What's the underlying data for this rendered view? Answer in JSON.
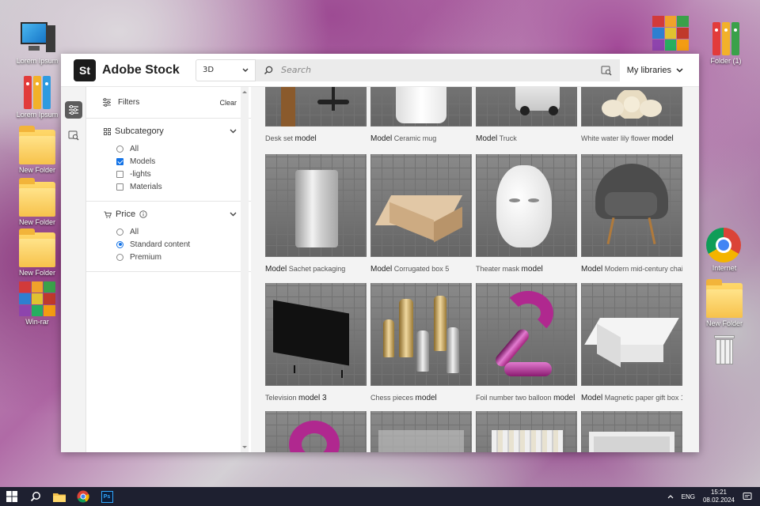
{
  "desktop": {
    "left_icons": [
      {
        "label": "Lorem Ipsum",
        "icon": "computer-icon"
      },
      {
        "label": "Lorem Ipsum",
        "icon": "binders-icon"
      },
      {
        "label": "New Folder",
        "icon": "folder-icon"
      },
      {
        "label": "New Folder",
        "icon": "folder-icon"
      },
      {
        "label": "New Folder",
        "icon": "folder-icon"
      },
      {
        "label": "Win-rar",
        "icon": "winrar-icon"
      }
    ],
    "right_icons": [
      {
        "label": "",
        "icon": "winrar-icon"
      },
      {
        "label": "Folder (1)",
        "icon": "binders-icon"
      },
      {
        "label": "Internet",
        "icon": "chrome-icon"
      },
      {
        "label": "New Folder",
        "icon": "folder-icon"
      },
      {
        "label": "",
        "icon": "recycle-bin-icon"
      }
    ]
  },
  "app": {
    "logo": "St",
    "name": "Adobe Stock",
    "category": "3D",
    "search_placeholder": "Search",
    "libraries": "My libraries"
  },
  "filters": {
    "title": "Filters",
    "clear": "Clear",
    "subcategory": {
      "title": "Subcategory",
      "options": [
        {
          "label": "All",
          "checked": false
        },
        {
          "label": "Models",
          "checked": true
        },
        {
          "label": "-lights",
          "checked": false
        },
        {
          "label": "Materials",
          "checked": false
        }
      ]
    },
    "price": {
      "title": "Price",
      "options": [
        {
          "label": "All",
          "selected": false
        },
        {
          "label": "Standard content",
          "selected": true
        },
        {
          "label": "Premium",
          "selected": false
        }
      ]
    }
  },
  "results": [
    {
      "pre": "Desk set",
      "bold": "model",
      "post": ""
    },
    {
      "pre": "",
      "bold": "Model",
      "post": "Ceramic mug"
    },
    {
      "pre": "",
      "bold": "Model",
      "post": "Truck"
    },
    {
      "pre": "White water lily flower",
      "bold": "model",
      "post": ""
    },
    {
      "pre": "",
      "bold": "Model",
      "post": "Sachet packaging"
    },
    {
      "pre": "",
      "bold": "Model",
      "post": "Corrugated box 5"
    },
    {
      "pre": "Theater mask",
      "bold": "model",
      "post": ""
    },
    {
      "pre": "",
      "bold": "Model",
      "post": "Modern mid-century chair"
    },
    {
      "pre": "Television",
      "bold": "model 3",
      "post": ""
    },
    {
      "pre": "Chess pieces",
      "bold": "model",
      "post": ""
    },
    {
      "pre": "Foil number two balloon",
      "bold": "model",
      "post": ""
    },
    {
      "pre": "",
      "bold": "Model",
      "post": "Magnetic paper gift box 1"
    },
    {
      "pre": "",
      "bold": "",
      "post": ""
    },
    {
      "pre": "",
      "bold": "",
      "post": ""
    },
    {
      "pre": "",
      "bold": "",
      "post": ""
    },
    {
      "pre": "",
      "bold": "",
      "post": ""
    }
  ],
  "taskbar": {
    "lang": "ENG",
    "time": "15:21",
    "date": "08.02.2024"
  }
}
